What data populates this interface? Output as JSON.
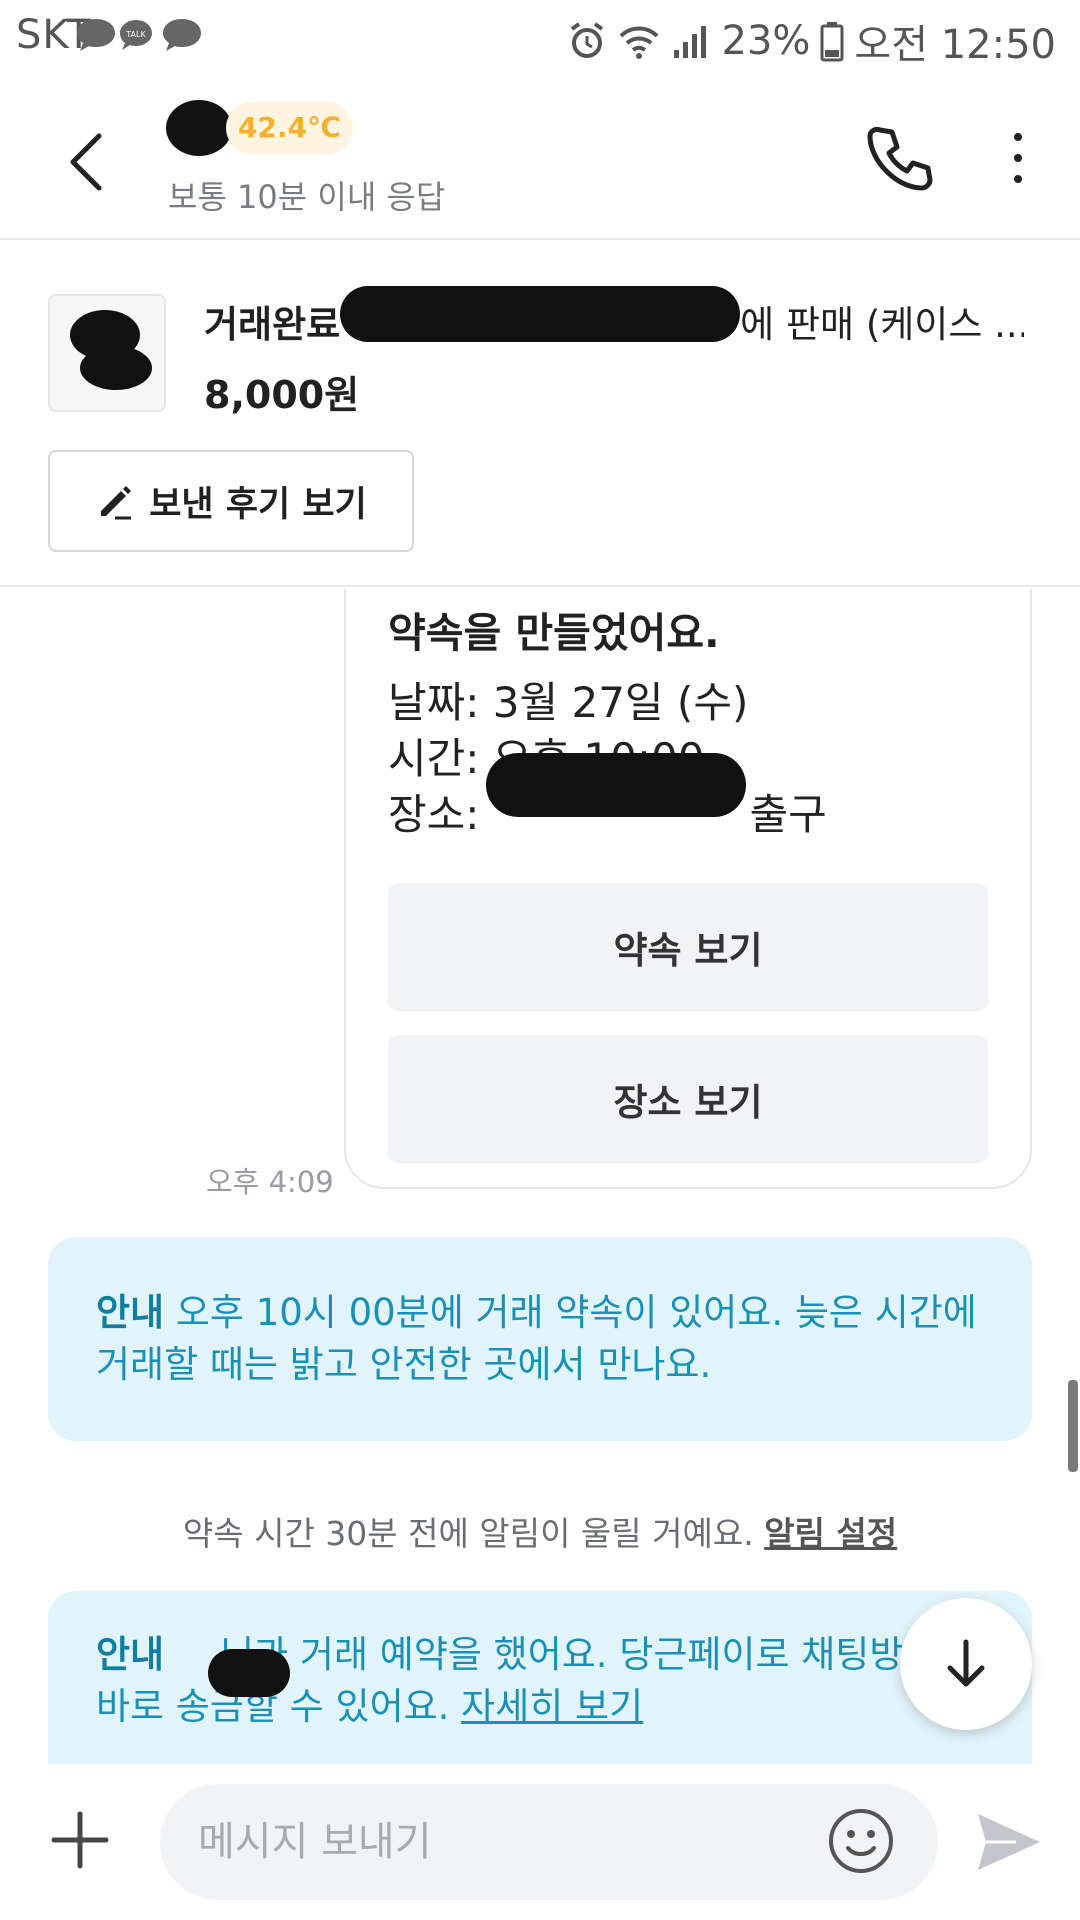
{
  "status_bar": {
    "carrier": "SKT",
    "notif_talk": "TALK",
    "battery": "23%",
    "time": "오전 12:50"
  },
  "header": {
    "manner_temp": "42.4℃",
    "response_time": "보통 10분 이내 응답"
  },
  "product": {
    "title_status": "거래완료",
    "title_rest": "에 판매 (케이스 ...",
    "price": "8,000원",
    "review_button": "보낸 후기 보기"
  },
  "promise_card": {
    "title": "약속을 만들었어요.",
    "date_line": "날짜: 3월 27일 (수)",
    "time_line": "시간: 오후 10:00",
    "place_prefix": "장소:",
    "place_suffix": "출구",
    "view_promise": "약속 보기",
    "view_place": "장소 보기",
    "sent_time": "오후 4:09"
  },
  "notice1": {
    "label": "안내",
    "text": " 오후 10시 00분에 거래 약속이 있어요. 늦은 시간에 거래할 때는 밝고 안전한 곳에서 만나요."
  },
  "alarm": {
    "text": "약속 시간 30분 전에 알림이 울릴 거예요. ",
    "link": "알림 설정"
  },
  "notice2": {
    "label": "안내",
    "text": "님과 거래 예약을 했어요. 당근페이로 채팅방에서 바로 송금할 수 있어요. ",
    "link": "자세히 보기"
  },
  "input": {
    "placeholder": "메시지 보내기"
  },
  "icons": {
    "back": "back-arrow-icon",
    "call": "phone-icon",
    "more": "more-vertical-icon",
    "edit": "pencil-icon",
    "plus": "plus-icon",
    "emoji": "smiley-icon",
    "send": "send-icon",
    "down": "arrow-down-icon"
  },
  "colors": {
    "temp": "#f6b02e",
    "notice_bg": "#e2f4fb",
    "notice_text": "#1a90b5"
  }
}
